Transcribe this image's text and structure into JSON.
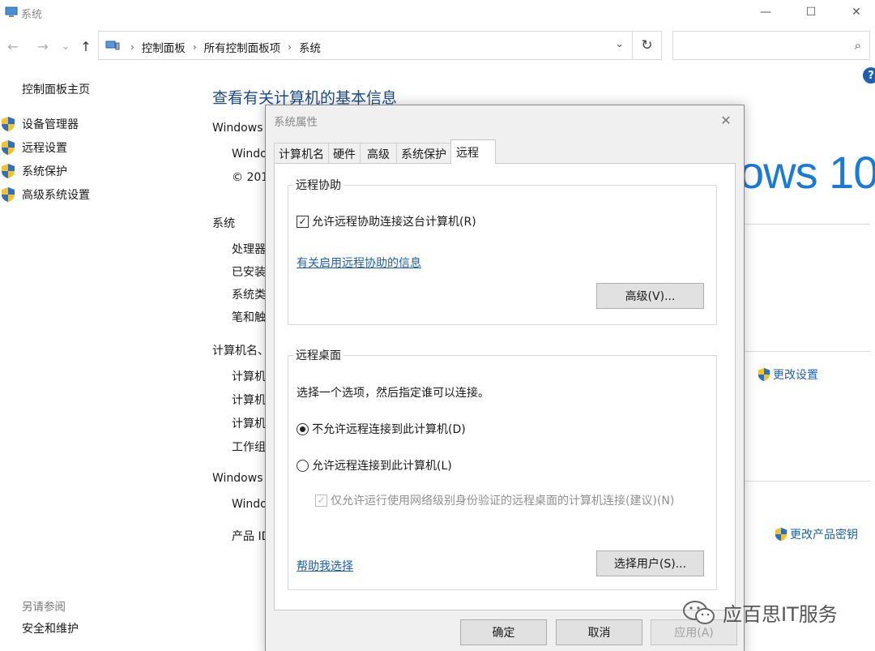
{
  "window": {
    "title": "系统",
    "minimize": "—",
    "maximize": "☐",
    "close": "✕"
  },
  "nav": {
    "back": "←",
    "forward": "→",
    "recent": "⌄",
    "up": "↑",
    "breadcrumbs": [
      "控制面板",
      "所有控制面板项",
      "系统"
    ],
    "separator": "›",
    "dropdown": "⌄",
    "refresh": "↻",
    "search_placeholder": "",
    "search_glyph": "⌕",
    "help": "?"
  },
  "sidebar": {
    "home": "控制面板主页",
    "items": [
      {
        "label": "设备管理器"
      },
      {
        "label": "远程设置"
      },
      {
        "label": "系统保护"
      },
      {
        "label": "高级系统设置"
      }
    ],
    "see_also": "另请参阅",
    "see_also_link": "安全和维护"
  },
  "main": {
    "title": "查看有关计算机的基本信息",
    "edition_heading": "Windows",
    "edition_line": "Windo",
    "copyright": "© 201",
    "logo_text": "ows 10",
    "system_heading": "系统",
    "system_rows": [
      "处理器",
      "已安装",
      "系统类",
      "笔和触"
    ],
    "computer_heading": "计算机名、",
    "computer_rows": [
      "计算机",
      "计算机",
      "计算机",
      "工作组"
    ],
    "change_settings": "更改设置",
    "activation_heading": "Windows",
    "activation_line": "Windo",
    "product_id": "产品 ID",
    "change_key": "更改产品密钥"
  },
  "dialog": {
    "title": "系统属性",
    "close": "✕",
    "tabs": [
      "计算机名",
      "硬件",
      "高级",
      "系统保护",
      "远程"
    ],
    "active_tab": "远程",
    "assist": {
      "group": "远程协助",
      "checkbox": "允许远程协助连接这台计算机(R)",
      "checkbox_checked": true,
      "link": "有关启用远程协助的信息",
      "advanced": "高级(V)..."
    },
    "desktop": {
      "group": "远程桌面",
      "prompt": "选择一个选项，然后指定谁可以连接。",
      "option_deny": "不允许远程连接到此计算机(D)",
      "option_allow": "允许远程连接到此计算机(L)",
      "nla": "仅允许运行使用网络级别身份验证的远程桌面的计算机连接(建议)(N)",
      "help_link": "帮助我选择",
      "select_users": "选择用户(S)..."
    },
    "ok": "确定",
    "cancel": "取消",
    "apply": "应用(A)"
  },
  "watermark": {
    "text": "应百思IT服务"
  },
  "colors": {
    "accent": "#1e5fb3",
    "logo": "#1a7ad4",
    "dialog_bg": "#f0f0f0"
  }
}
